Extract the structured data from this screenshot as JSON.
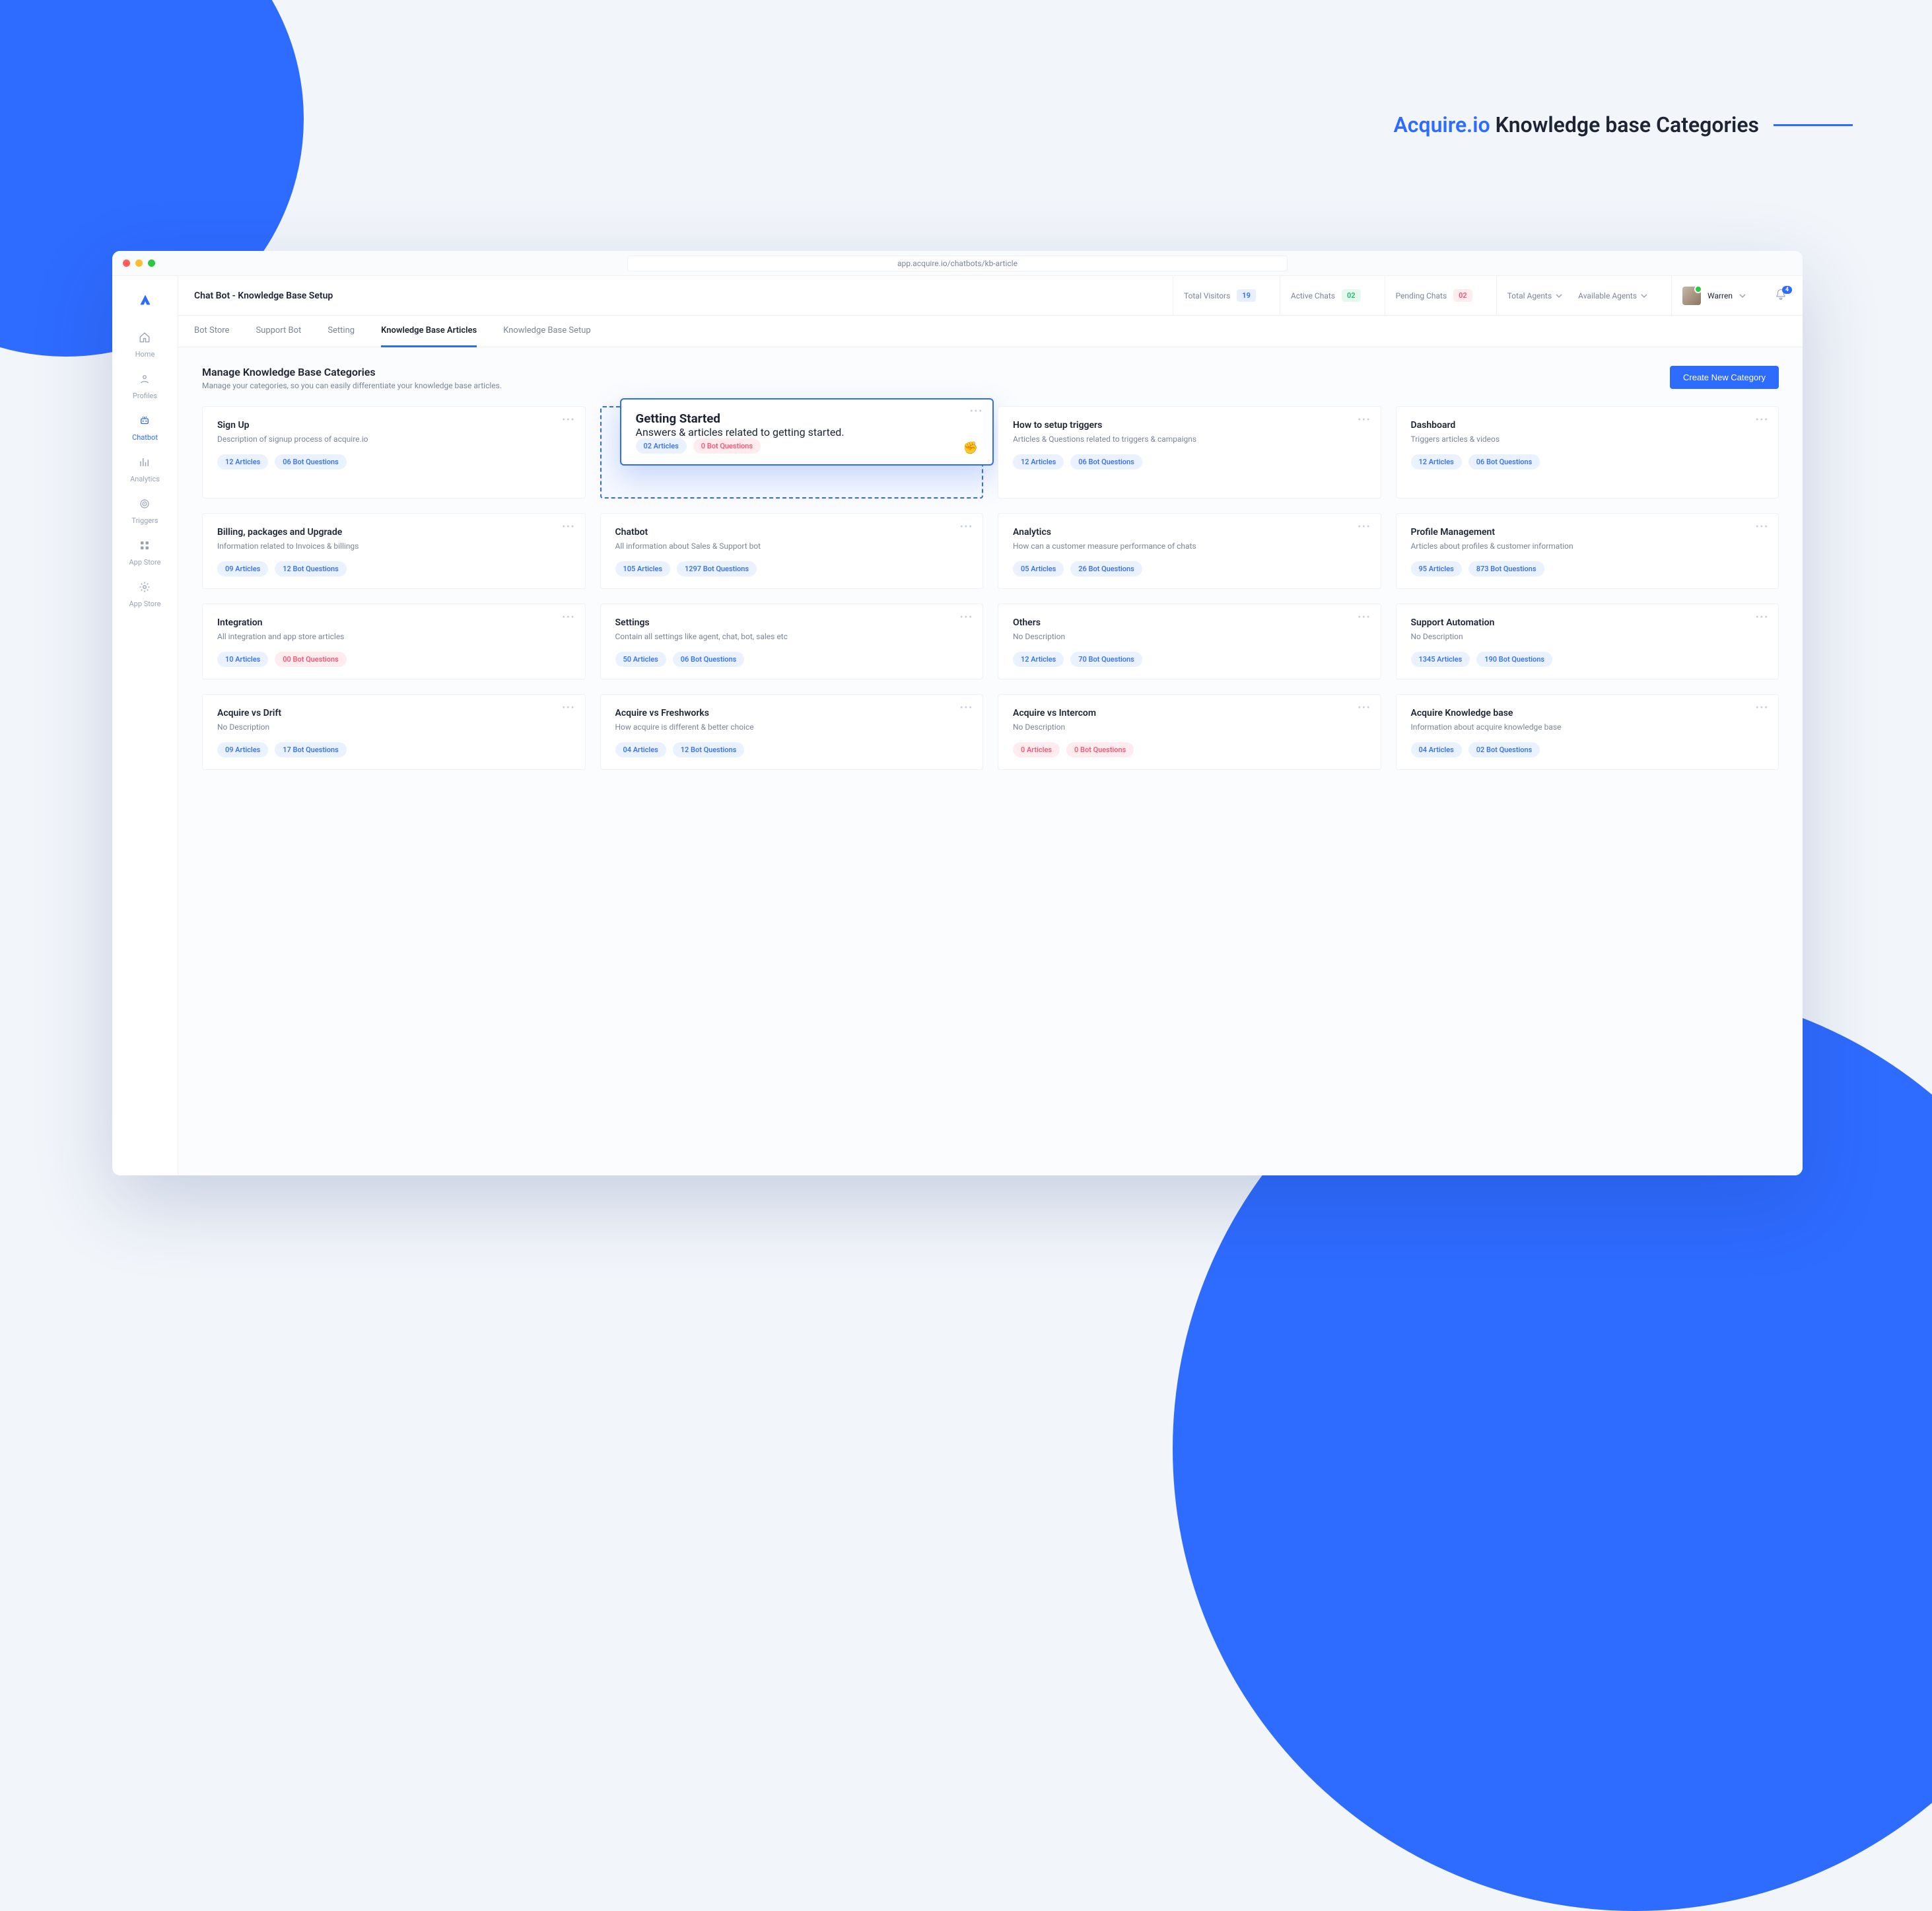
{
  "page_heading": {
    "brand": "Acquire.io",
    "rest": "Knowledge base Categories"
  },
  "browser": {
    "url": "app.acquire.io/chatbots/kb-article"
  },
  "sidebar": {
    "items": [
      {
        "key": "home",
        "label": "Home",
        "icon": "home-icon"
      },
      {
        "key": "profiles",
        "label": "Profiles",
        "icon": "profiles-icon"
      },
      {
        "key": "chatbot",
        "label": "Chatbot",
        "icon": "bot-icon",
        "active": true
      },
      {
        "key": "analytics",
        "label": "Analytics",
        "icon": "analytics-icon"
      },
      {
        "key": "triggers",
        "label": "Triggers",
        "icon": "radar-icon"
      },
      {
        "key": "appstore1",
        "label": "App Store",
        "icon": "apps-icon"
      },
      {
        "key": "appstore2",
        "label": "App Store",
        "icon": "gear-icon"
      }
    ]
  },
  "topbar": {
    "title": "Chat Bot - Knowledge Base Setup",
    "stats": {
      "visitors_label": "Total Visitors",
      "visitors_value": "19",
      "active_label": "Active Chats",
      "active_value": "02",
      "pending_label": "Pending Chats",
      "pending_value": "02"
    },
    "dropdowns": {
      "total_agents": "Total Agents",
      "available_agents": "Available Agents"
    },
    "user_name": "Warren",
    "notifications_count": "4"
  },
  "tabs": [
    {
      "label": "Bot Store"
    },
    {
      "label": "Support Bot"
    },
    {
      "label": "Setting"
    },
    {
      "label": "Knowledge Base Articles",
      "active": true
    },
    {
      "label": "Knowledge Base Setup"
    }
  ],
  "content_head": {
    "title": "Manage Knowledge Base Categories",
    "subtitle": "Manage your categories, so you can easily differentiate your knowledge base articles.",
    "primary_button": "Create New Category"
  },
  "pill_suffix": {
    "articles": "Articles",
    "questions": "Bot Questions"
  },
  "cards": [
    {
      "title": "Sign Up",
      "desc": "Description of signup process of acquire.io",
      "articles": "12",
      "questions": "06"
    },
    {
      "title": "Getting Started",
      "desc": "Answers & articles related to getting started.",
      "articles": "02",
      "questions": "0",
      "q_zero": true,
      "dragging": true
    },
    {
      "title": "How to setup triggers",
      "desc": "Articles & Questions related to triggers & campaigns",
      "articles": "12",
      "questions": "06"
    },
    {
      "title": "Dashboard",
      "desc": "Triggers articles & videos",
      "articles": "12",
      "questions": "06"
    },
    {
      "title": "Billing, packages and Upgrade",
      "desc": "Information related to Invoices & billings",
      "articles": "09",
      "questions": "12"
    },
    {
      "title": "Chatbot",
      "desc": "All information about Sales & Support bot",
      "articles": "105",
      "questions": "1297"
    },
    {
      "title": "Analytics",
      "desc": "How can a customer measure performance of chats",
      "articles": "05",
      "questions": "26"
    },
    {
      "title": "Profile Management",
      "desc": "Articles about profiles & customer information",
      "articles": "95",
      "questions": "873"
    },
    {
      "title": "Integration",
      "desc": "All integration and app store articles",
      "articles": "10",
      "questions": "00",
      "q_zero": true
    },
    {
      "title": "Settings",
      "desc": "Contain all settings like agent, chat, bot, sales etc",
      "articles": "50",
      "questions": "06"
    },
    {
      "title": "Others",
      "desc": "No Description",
      "articles": "12",
      "questions": "70"
    },
    {
      "title": "Support Automation",
      "desc": "No Description",
      "articles": "1345",
      "questions": "190"
    },
    {
      "title": "Acquire vs Drift",
      "desc": "No Description",
      "articles": "09",
      "questions": "17"
    },
    {
      "title": "Acquire vs Freshworks",
      "desc": "How acquire is different & better choice",
      "articles": "04",
      "questions": "12"
    },
    {
      "title": "Acquire vs Intercom",
      "desc": "No Description",
      "articles": "0",
      "questions": "0",
      "a_zero": true,
      "q_zero": true
    },
    {
      "title": "Acquire Knowledge base",
      "desc": "Information about acquire knowledge base",
      "articles": "04",
      "questions": "02"
    }
  ]
}
